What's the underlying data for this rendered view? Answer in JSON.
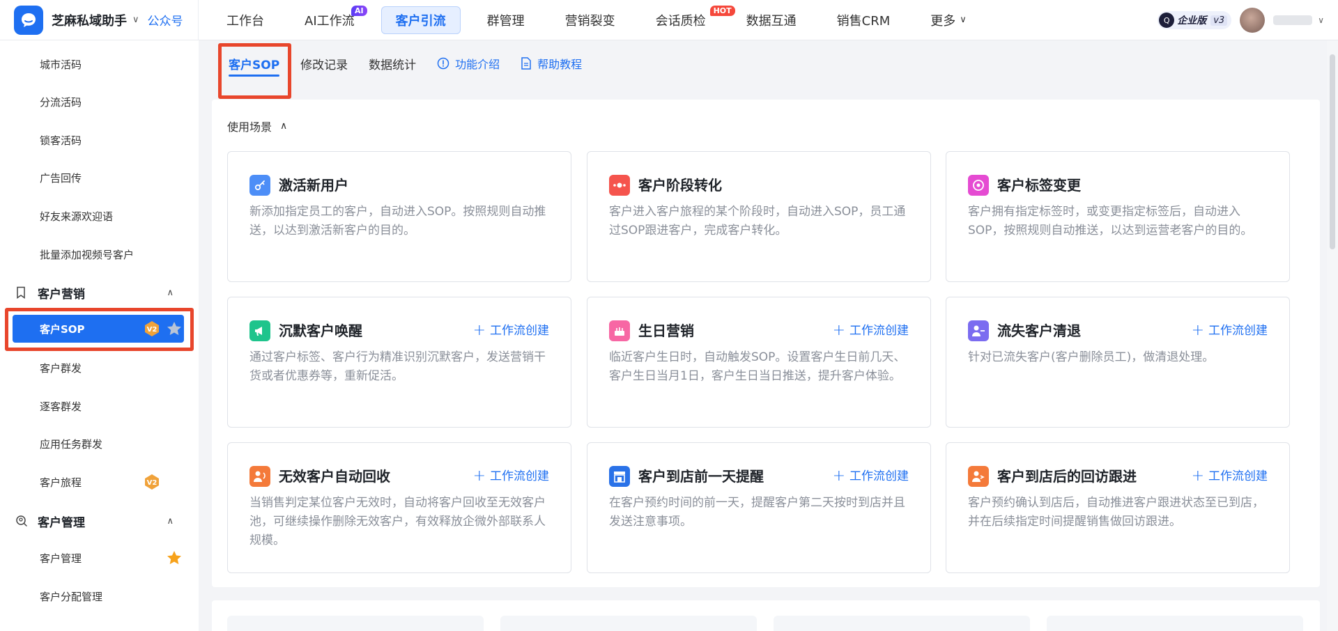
{
  "header": {
    "brand_name": "芝麻私域助手",
    "brand_switch": "公众号",
    "nav": [
      {
        "label": "工作台"
      },
      {
        "label": "AI工作流",
        "badge": "AI"
      },
      {
        "label": "客户引流",
        "active": true
      },
      {
        "label": "群管理"
      },
      {
        "label": "营销裂变"
      },
      {
        "label": "会话质检",
        "badge": "HOT"
      },
      {
        "label": "数据互通"
      },
      {
        "label": "销售CRM"
      },
      {
        "label": "更多"
      }
    ],
    "edition": "企业版",
    "edition_version": "v3",
    "edition_logo_text": "Q"
  },
  "sidebar": {
    "items_top": [
      "城市活码",
      "分流活码",
      "锁客活码",
      "广告回传",
      "好友来源欢迎语",
      "批量添加视频号客户"
    ],
    "group_marketing": "客户营销",
    "items_marketing": [
      "客户SOP",
      "客户群发",
      "逐客群发",
      "应用任务群发",
      "客户旅程"
    ],
    "group_management": "客户管理",
    "items_management": [
      "客户管理",
      "客户分配管理"
    ],
    "v2_badge": "V2"
  },
  "tabs": {
    "sop": "客户SOP",
    "history": "修改记录",
    "stats": "数据统计",
    "intro": "功能介绍",
    "help": "帮助教程"
  },
  "scenes": {
    "heading": "使用场景",
    "action_label": "工作流创建",
    "cards": [
      {
        "title": "激活新用户",
        "desc": "新添加指定员工的客户，自动进入SOP。按照规则自动推送，以达到激活新客户的目的。",
        "icon": "key-icon",
        "color": "#4d8ef7"
      },
      {
        "title": "客户阶段转化",
        "desc": "客户进入客户旅程的某个阶段时，自动进入SOP，员工通过SOP跟进客户，完成客户转化。",
        "icon": "funnel-icon",
        "color": "#f5544d"
      },
      {
        "title": "客户标签变更",
        "desc": "客户拥有指定标签时，或变更指定标签后，自动进入SOP，按照规则自动推送，以达到运营老客户的目的。",
        "icon": "tag-icon",
        "color": "#e54bd2"
      },
      {
        "title": "沉默客户唤醒",
        "desc": "通过客户标签、客户行为精准识别沉默客户，发送营销干货或者优惠券等，重新促活。",
        "icon": "megaphone-icon",
        "color": "#1ec48c"
      },
      {
        "title": "生日营销",
        "desc": "临近客户生日时，自动触发SOP。设置客户生日前几天、客户生日当月1日，客户生日当日推送，提升客户体验。",
        "icon": "cake-icon",
        "color": "#f767a4"
      },
      {
        "title": "流失客户清退",
        "desc": "针对已流失客户(客户删除员工)，做清退处理。",
        "icon": "user-minus-icon",
        "color": "#7b6cf0"
      },
      {
        "title": "无效客户自动回收",
        "desc": "当销售判定某位客户无效时，自动将客户回收至无效客户池，可继续操作删除无效客户，有效释放企微外部联系人规模。",
        "icon": "recycle-user-icon",
        "color": "#f47a3a"
      },
      {
        "title": "客户到店前一天提醒",
        "desc": "在客户预约时间的前一天，提醒客户第二天按时到店并且发送注意事项。",
        "icon": "store-icon",
        "color": "#2a72e8"
      },
      {
        "title": "客户到店后的回访跟进",
        "desc": "客户预约确认到店后，自动推进客户跟进状态至已到店，并在后续指定时间提醒销售做回访跟进。",
        "icon": "user-arrow-icon",
        "color": "#f47a3a"
      }
    ]
  },
  "colors": {
    "primary": "#1e6ff1",
    "highlight": "#e8462c",
    "badge_orange": "#f0a23a",
    "star": "#f7a21b"
  }
}
